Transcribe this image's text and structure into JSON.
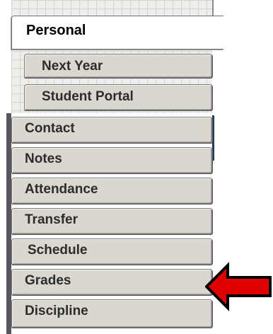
{
  "tabs": {
    "active": "Personal",
    "sub_items": [
      "Next Year",
      "Student Portal"
    ],
    "items": [
      "Contact",
      "Notes",
      "Attendance",
      "Transfer",
      "Schedule",
      "Grades",
      "Discipline"
    ]
  },
  "annotation": {
    "arrow_color": "#e00000",
    "arrow_outline": "#000000",
    "icon": "left-arrow-icon"
  }
}
